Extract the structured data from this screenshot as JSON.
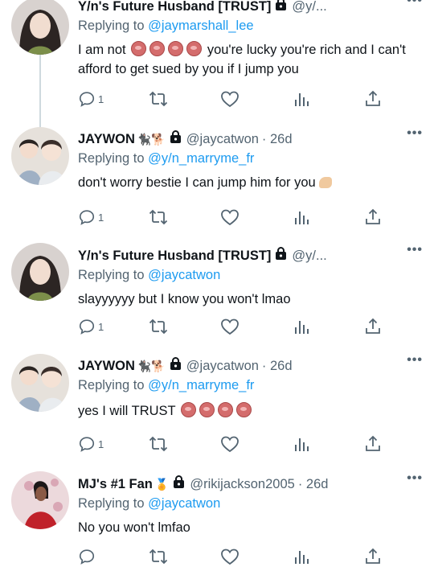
{
  "tweets": [
    {
      "name": "Y/n's Future Husband [TRUST]",
      "handle": "@y/...",
      "date": "",
      "emojis": "",
      "reply_prefix": "Replying to",
      "reply_to": "@jaymarshall_lee",
      "text_before": "I am not",
      "reaction_count": 4,
      "text_after": "you're lucky you're rich and I can't afford to get sued by you if I jump you",
      "reply_count": "1"
    },
    {
      "name": "JAYWON",
      "handle": "@jaycatwon",
      "date": "· 26d",
      "emojis": "🐈‍⬛🐕",
      "reply_prefix": "Replying to",
      "reply_to": "@y/n_marryme_fr",
      "text": "don't worry bestie I can jump him for you",
      "reply_count": "1"
    },
    {
      "name": "Y/n's Future Husband [TRUST]",
      "handle": "@y/...",
      "date": "",
      "emojis": "",
      "reply_prefix": "Replying to",
      "reply_to": "@jaycatwon",
      "text": "slayyyyyy but I know you won't lmao",
      "reply_count": "1"
    },
    {
      "name": "JAYWON",
      "handle": "@jaycatwon",
      "date": "· 26d",
      "emojis": "🐈‍⬛🐕",
      "reply_prefix": "Replying to",
      "reply_to": "@y/n_marryme_fr",
      "text": "yes I will TRUST",
      "reaction_count": 4,
      "reply_count": "1"
    },
    {
      "name": "MJ's #1 Fan",
      "handle": "@rikijackson2005",
      "date": "· 26d",
      "emojis": "🏅",
      "reply_prefix": "Replying to",
      "reply_to": "@jaycatwon",
      "text": "No you won't lmfao",
      "reply_count": ""
    }
  ],
  "more_label": "•••",
  "colors": {
    "link": "#1d9bf0",
    "secondary": "#536471",
    "text": "#0f1419"
  },
  "icons": [
    "reply-icon",
    "retweet-icon",
    "like-icon",
    "views-icon",
    "share-icon",
    "lock-icon",
    "more-icon"
  ]
}
